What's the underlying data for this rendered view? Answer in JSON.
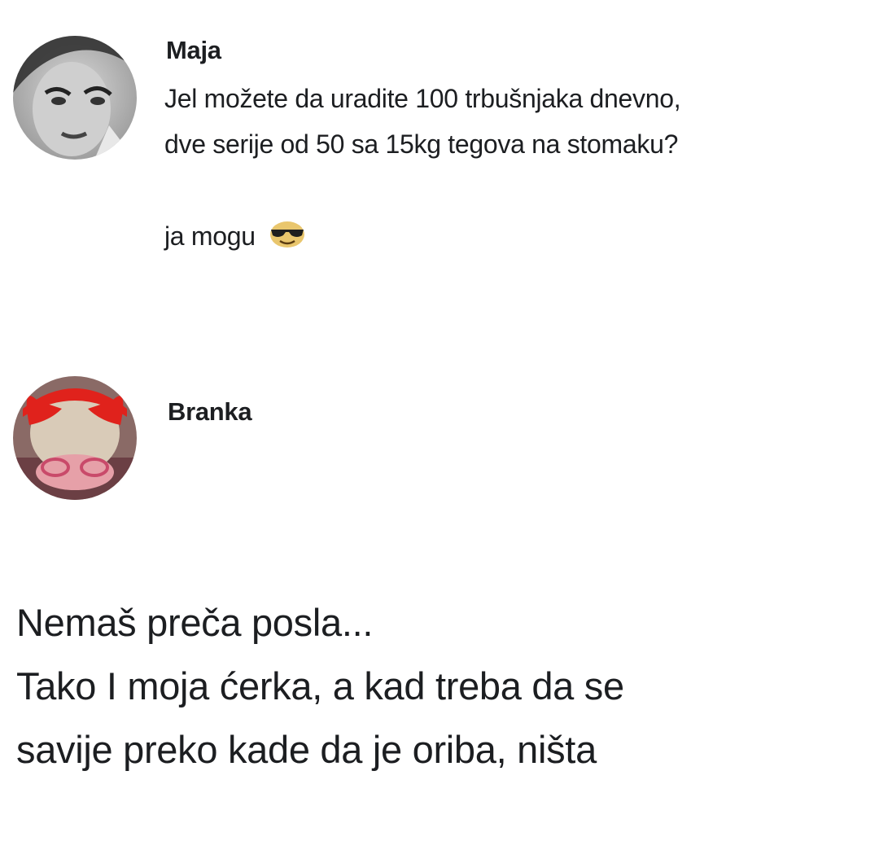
{
  "comments": [
    {
      "author": "Maja",
      "lines": [
        "Jel možete da uradite 100 trbušnjaka dnevno,",
        "dve serije od 50 sa 15kg tegova na stomaku?"
      ],
      "reply_line": "ja mogu",
      "emoji": "sunglasses-face-icon"
    },
    {
      "author": "Branka"
    }
  ],
  "reply_text": {
    "lines": [
      "Nemaš preča posla...",
      "Tako I moja ćerka, a kad treba da se",
      "savije preko kade da je oriba, ništa"
    ]
  }
}
